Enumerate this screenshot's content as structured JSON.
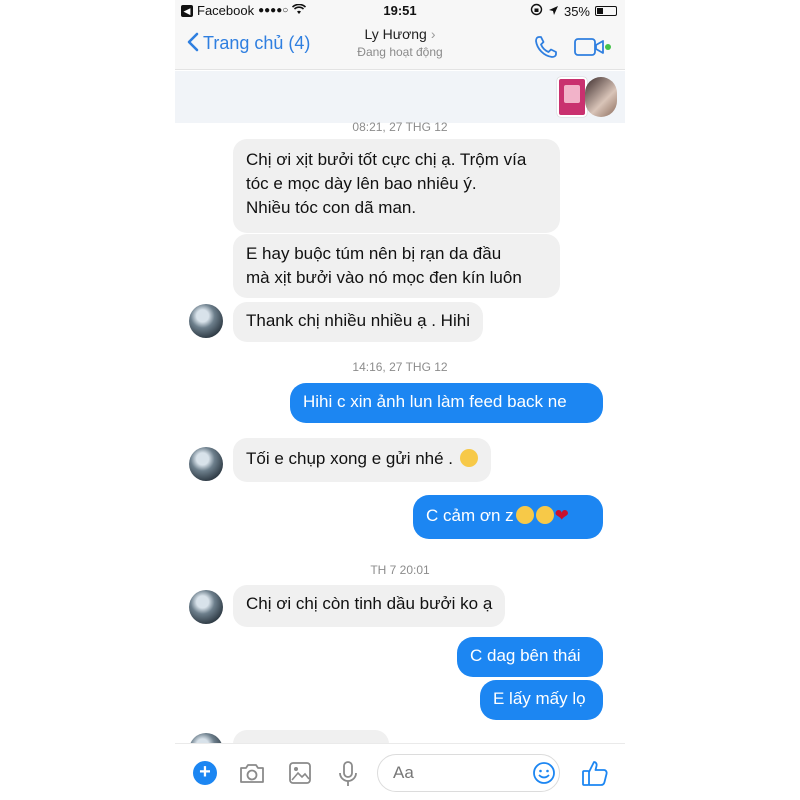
{
  "status_bar": {
    "carrier": "Facebook",
    "signal": "●●●●○",
    "time": "19:51",
    "battery_text": "35%",
    "battery_level": 0.35
  },
  "nav": {
    "back_label": "Trang chủ (4)",
    "contact_name": "Ly Hương",
    "contact_status": "Đang hoạt động",
    "icons": [
      "back-chevron-icon",
      "phone-icon",
      "video-camera-icon"
    ]
  },
  "chat": {
    "dividers": [
      "08:21, 27 THG 12",
      "14:16, 27 THG 12",
      "TH 7 20:01"
    ],
    "messages": [
      {
        "from": "them",
        "lines": [
          "Chị ơi xịt bưởi tốt cực chị ạ. Trộm vía",
          "tóc e mọc dày lên bao nhiêu ý.",
          "Nhiều tóc con dã man."
        ]
      },
      {
        "from": "them",
        "lines": [
          "E hay buộc túm nên bị rạn da đầu",
          "mà xịt bưởi vào nó mọc đen kín luôn"
        ]
      },
      {
        "from": "them",
        "lines": [
          "Thank chị nhiều nhiều ạ . Hihi"
        ]
      },
      {
        "from": "me",
        "lines": [
          "Hihi c xin ảnh lun làm feed back ne"
        ]
      },
      {
        "from": "them",
        "lines": [
          "Tối e chụp xong e gửi nhé ."
        ]
      },
      {
        "from": "me",
        "lines": [
          "C cảm ơn z"
        ]
      },
      {
        "from": "them",
        "lines": [
          "Chị ơi chị còn tinh dầu bưởi ko ạ"
        ]
      },
      {
        "from": "me",
        "lines": [
          "C dag bên thái"
        ]
      },
      {
        "from": "me",
        "lines": [
          "E lấy mấy lọ"
        ]
      }
    ]
  },
  "composer": {
    "placeholder": "Aa",
    "icons": [
      "plus-icon",
      "camera-icon",
      "image-icon",
      "microphone-icon",
      "smiley-icon",
      "thumbs-up-icon"
    ]
  },
  "colors": {
    "accent": "#1c86f2",
    "incoming_bubble": "#f0f0f0",
    "nav_link": "#2f7fe0"
  }
}
